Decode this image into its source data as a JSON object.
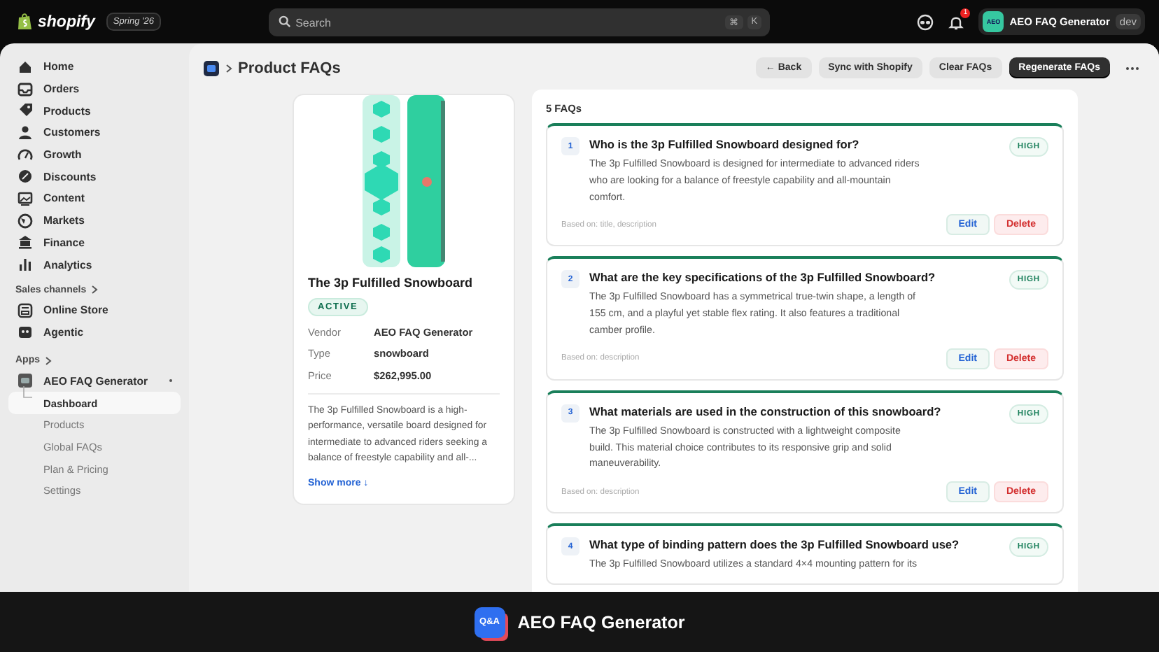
{
  "top_bar": {
    "brand": "shopify",
    "edition": "Spring '26",
    "search": {
      "placeholder": "Search",
      "shortcut": [
        "⌘",
        "K"
      ]
    },
    "notification_count": "1",
    "account": {
      "avatar": "AEO",
      "name": "AEO FAQ Generator",
      "badge": "dev"
    }
  },
  "sidebar": {
    "items": [
      {
        "label": "Home",
        "selected": false
      },
      {
        "label": "Orders",
        "selected": false
      },
      {
        "label": "Products",
        "selected": false
      },
      {
        "label": "Customers",
        "selected": false
      },
      {
        "label": "Growth",
        "selected": false
      },
      {
        "label": "Discounts",
        "selected": false
      },
      {
        "label": "Content",
        "selected": false
      },
      {
        "label": "Markets",
        "selected": false
      },
      {
        "label": "Finance",
        "selected": false
      },
      {
        "label": "Analytics",
        "selected": false
      }
    ],
    "sales_channels": {
      "heading": "Sales channels",
      "items": [
        {
          "label": "Online Store",
          "selected": false
        },
        {
          "label": "Agentic",
          "selected": false
        }
      ]
    },
    "apps": {
      "heading": "Apps",
      "app": {
        "name": "AEO FAQ Generator",
        "items": [
          {
            "label": "Dashboard",
            "selected": true
          },
          {
            "label": "Products",
            "selected": false
          },
          {
            "label": "Global FAQs",
            "selected": false
          },
          {
            "label": "Plan & Pricing",
            "selected": false
          },
          {
            "label": "Settings",
            "selected": false
          }
        ]
      }
    }
  },
  "header": {
    "title": "Product FAQs",
    "buttons": [
      {
        "label": "← Back",
        "kind": "secondary"
      },
      {
        "label": "Sync with Shopify",
        "kind": "secondary"
      },
      {
        "label": "Clear FAQs",
        "kind": "secondary"
      },
      {
        "label": "Regenerate FAQs",
        "kind": "primary"
      }
    ]
  },
  "product": {
    "name": "The 3p Fulfilled Snowboard",
    "status": "ACTIVE",
    "details": [
      {
        "label": "Vendor",
        "value": "AEO FAQ Generator"
      },
      {
        "label": "Type",
        "value": "snowboard"
      },
      {
        "label": "Price",
        "value": "$262,995.00"
      }
    ],
    "description": "The 3p Fulfilled Snowboard is a high-performance, versatile board designed for intermediate to advanced riders seeking a balance of freestyle capability and all-...",
    "show_more": "Show more ↓"
  },
  "faqs": {
    "count": "5 FAQs",
    "items": [
      {
        "number": "1",
        "question": "Who is the 3p Fulfilled Snowboard designed for?",
        "answer": "The 3p Fulfilled Snowboard is designed for intermediate to advanced riders who are looking for a balance of freestyle capability and all-mountain comfort.",
        "priority": "HIGH",
        "source": "Based on: title, description",
        "actions": [
          "Edit",
          "Delete"
        ]
      },
      {
        "number": "2",
        "question": "What are the key specifications of the 3p Fulfilled Snowboard?",
        "answer": "The 3p Fulfilled Snowboard has a symmetrical true-twin shape, a length of 155 cm, and a playful yet stable flex rating. It also features a traditional camber profile.",
        "priority": "HIGH",
        "source": "Based on: description",
        "actions": [
          "Edit",
          "Delete"
        ]
      },
      {
        "number": "3",
        "question": "What materials are used in the construction of this snowboard?",
        "answer": "The 3p Fulfilled Snowboard is constructed with a lightweight composite build. This material choice contributes to its responsive grip and solid maneuverability.",
        "priority": "HIGH",
        "source": "Based on: description",
        "actions": [
          "Edit",
          "Delete"
        ]
      },
      {
        "number": "4",
        "question": "What type of binding pattern does the 3p Fulfilled Snowboard use?",
        "answer": "The 3p Fulfilled Snowboard utilizes a standard 4×4 mounting pattern for its",
        "priority": "HIGH"
      }
    ]
  },
  "bottom_bar": {
    "logo_text": "Q&A",
    "title": "AEO FAQ Generator"
  }
}
